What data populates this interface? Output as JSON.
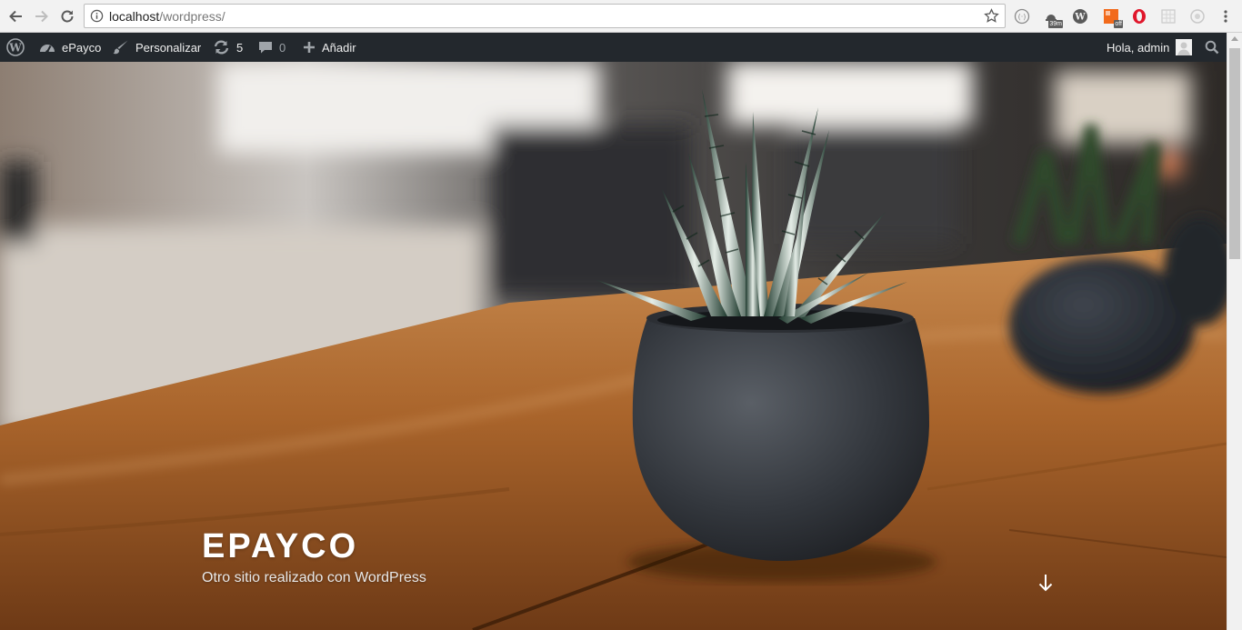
{
  "browser": {
    "url_host": "localhost",
    "url_path": "/wordpress/",
    "extensions": [
      {
        "name": "reader-icon"
      },
      {
        "name": "timer-extension-icon",
        "badge": "39m"
      },
      {
        "name": "wordpress-extension-icon"
      },
      {
        "name": "mixed-content-extension-icon",
        "badge": "off"
      },
      {
        "name": "opera-icon"
      },
      {
        "name": "grid-extension-icon"
      },
      {
        "name": "privacy-extension-icon"
      }
    ]
  },
  "adminbar": {
    "site_name": "ePayco",
    "customize": "Personalizar",
    "updates_count": "5",
    "comments_count": "0",
    "add_new": "Añadir",
    "greeting": "Hola, admin"
  },
  "hero": {
    "site_title": "EPAYCO",
    "site_description": "Otro sitio realizado con WordPress"
  },
  "colors": {
    "adminbar_bg": "#23282d",
    "chrome_bg": "#f2f2f2",
    "wood": "#a9642b"
  }
}
